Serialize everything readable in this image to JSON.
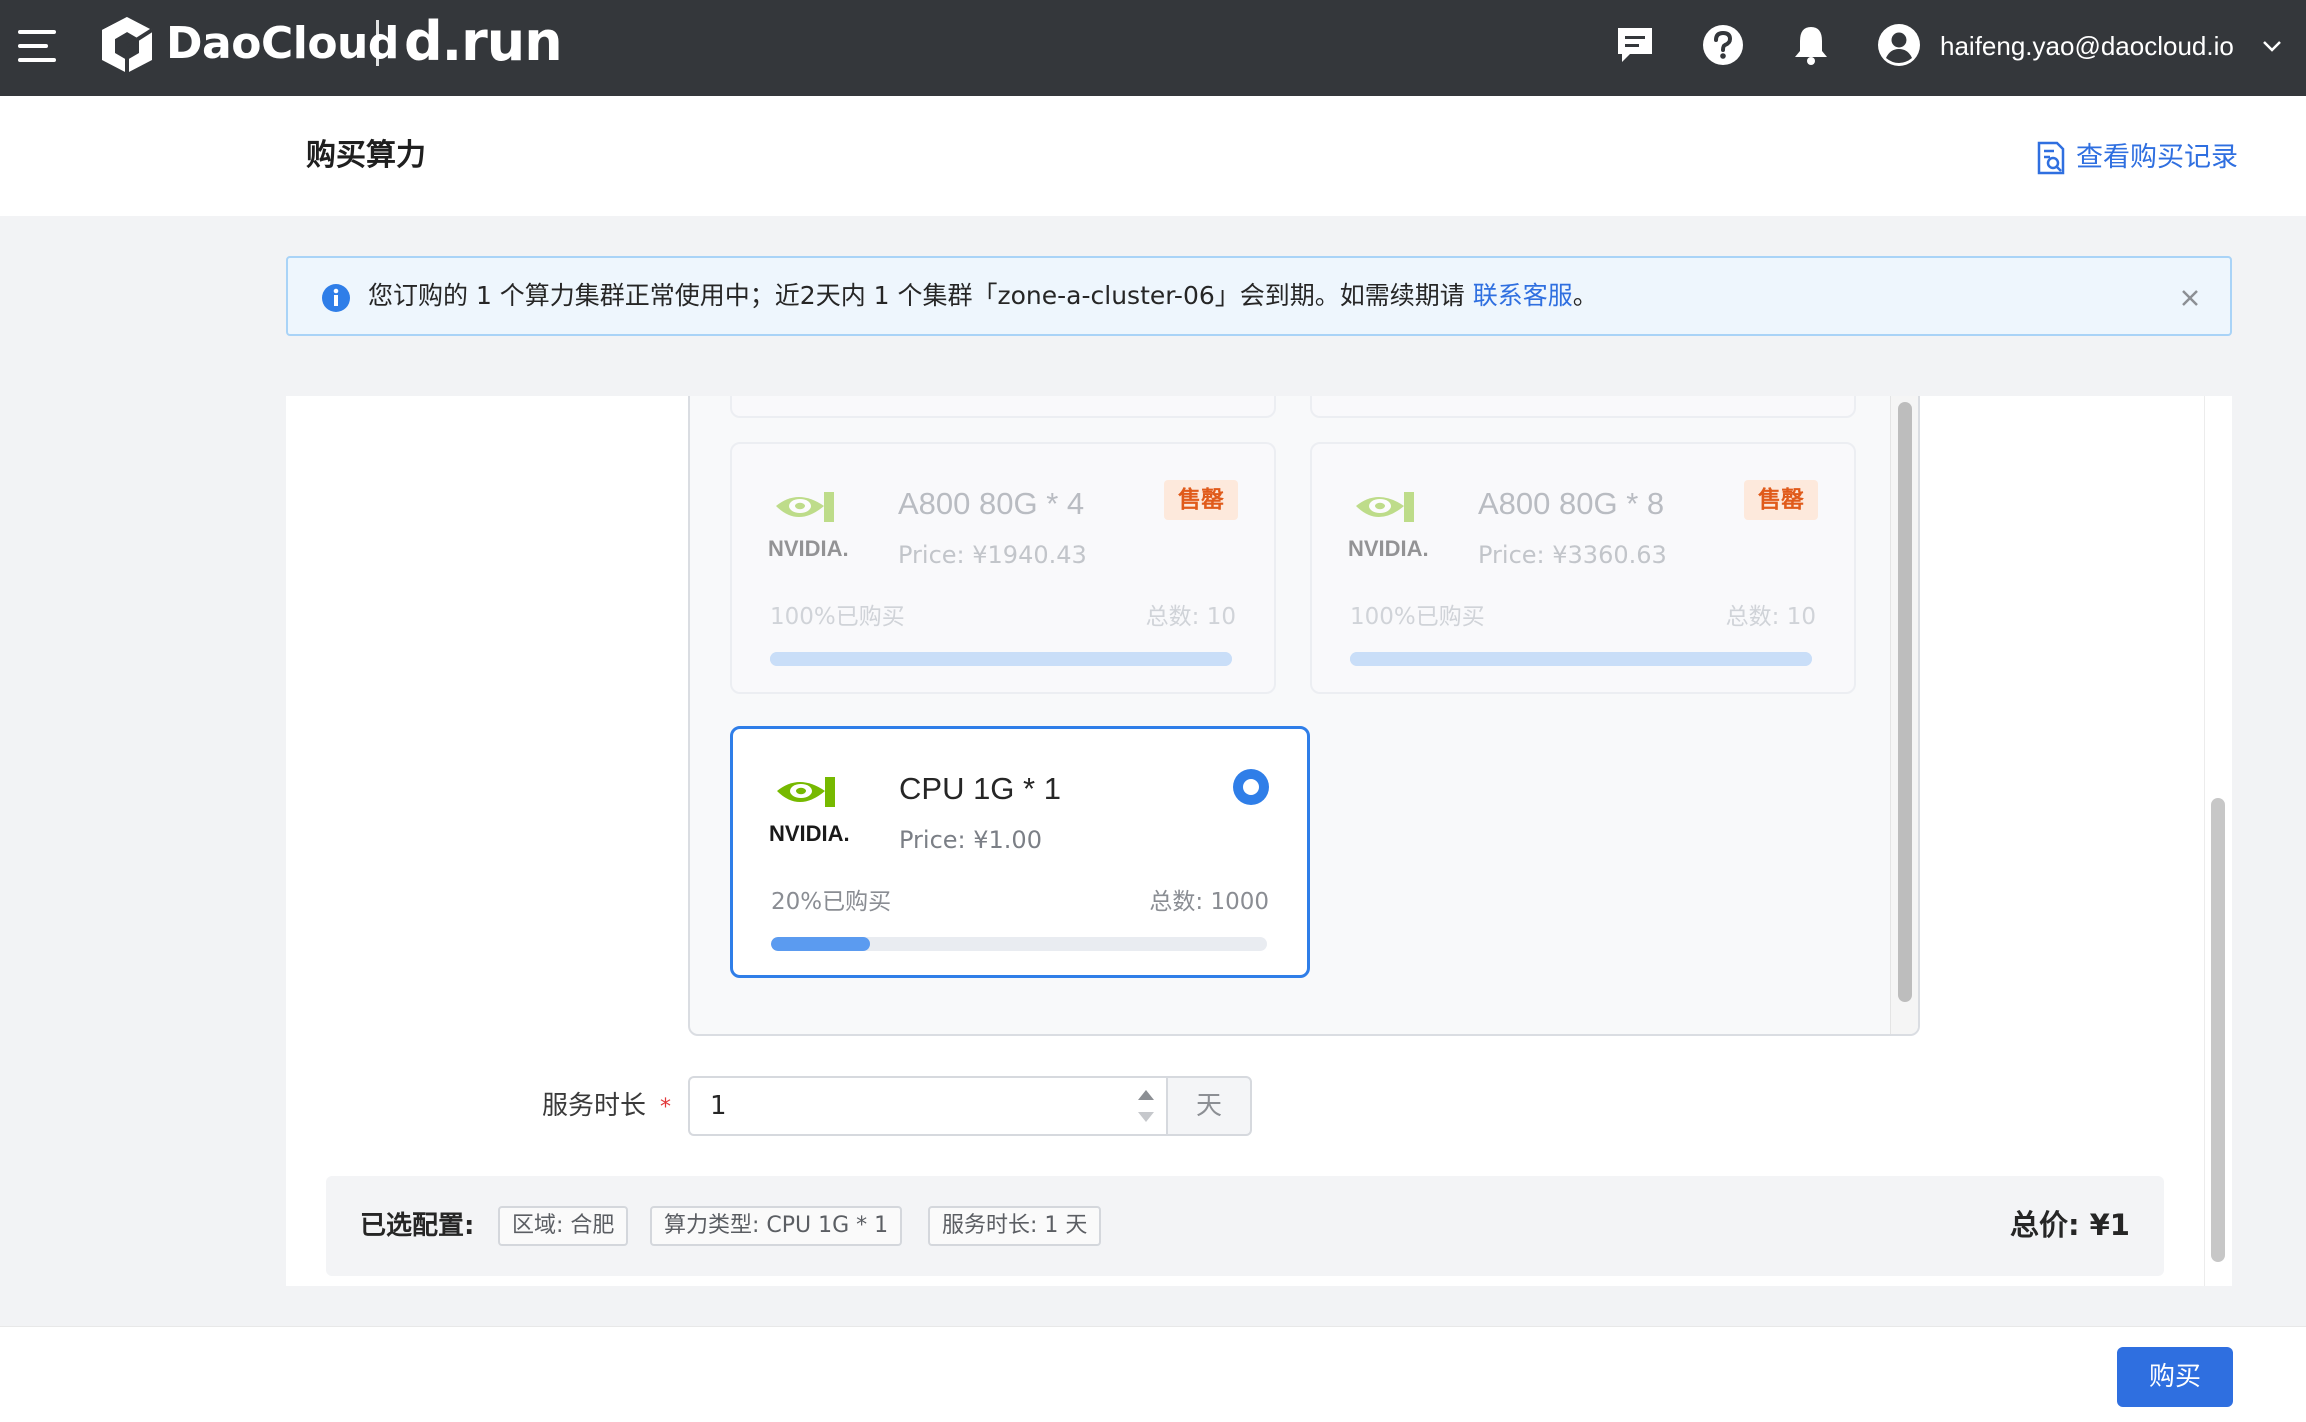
{
  "nav": {
    "brand": "DaoCloud",
    "product": "d.run",
    "user_email": "haifeng.yao@daocloud.io",
    "icons": [
      "menu-icon",
      "chat-icon",
      "help-icon",
      "bell-icon",
      "user-avatar-icon",
      "chevron-down-icon"
    ]
  },
  "header": {
    "title": "购买算力",
    "history_link": "查看购买记录"
  },
  "alert": {
    "message_before": "您订购的 1 个算力集群正常使用中；近2天内 1 个集群「zone-a-cluster-06」会到期。如需续期请 ",
    "link_text": "联系客服",
    "message_after": "。"
  },
  "cards": [
    {
      "name": "A800 80G * 4",
      "price": "Price: ¥1940.43",
      "bought_text": "100%已购买",
      "total_text": "总数: 10",
      "progress": 1.0,
      "badge": "售罄",
      "state": "sold-out"
    },
    {
      "name": "A800 80G * 8",
      "price": "Price: ¥3360.63",
      "bought_text": "100%已购买",
      "total_text": "总数: 10",
      "progress": 1.0,
      "badge": "售罄",
      "state": "sold-out"
    },
    {
      "name": "CPU 1G * 1",
      "price": "Price: ¥1.00",
      "bought_text": "20%已购买",
      "total_text": "总数: 1000",
      "progress": 0.2,
      "badge": "",
      "state": "selected"
    }
  ],
  "duration": {
    "label": "服务时长",
    "required_mark": "*",
    "value": "1",
    "unit": "天"
  },
  "summary": {
    "label": "已选配置:",
    "tags": [
      "区域: 合肥",
      "算力类型: CPU 1G * 1",
      "服务时长: 1 天"
    ],
    "total": "总价: ¥1"
  },
  "footer": {
    "buy_label": "购买"
  },
  "colors": {
    "nav_bg": "#34373b",
    "primary": "#2f6fe0",
    "nvidia_green": "#76b900",
    "soldout_bg": "#fde9dc",
    "soldout_text": "#e05a1a"
  }
}
